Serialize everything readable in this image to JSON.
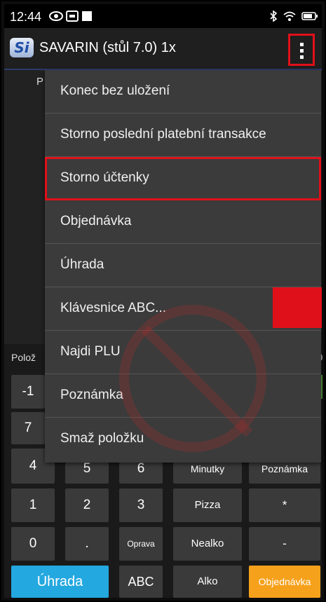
{
  "status_bar": {
    "time": "12:44"
  },
  "app_bar": {
    "logo": "Si",
    "title": "SAVARIN (stůl 7.0) 1x"
  },
  "background": {
    "partial_label": "P",
    "polozka_label": "Polož",
    "right_edge": "0"
  },
  "menu": {
    "items": [
      {
        "label": "Konec bez uložení"
      },
      {
        "label": "Storno poslední platební transakce"
      },
      {
        "label": "Storno účtenky"
      },
      {
        "label": "Objednávka"
      },
      {
        "label": "Úhrada"
      },
      {
        "label": "Klávesnice ABC..."
      },
      {
        "label": "Najdi PLU"
      },
      {
        "label": "Poznámka"
      },
      {
        "label": "Smaž položku"
      }
    ]
  },
  "keypad": {
    "row1": [
      "-1"
    ],
    "row2": [
      "7"
    ],
    "row3": [
      "4",
      "5",
      "6",
      "Minutky",
      "Poznámka"
    ],
    "row4": [
      "1",
      "2",
      "3",
      "Pizza",
      "*"
    ],
    "row5": [
      "0",
      ".",
      "Oprava",
      "Nealko",
      "-"
    ],
    "row6": [
      "Úhrada",
      "ABC",
      "Alko",
      "Objednávka"
    ]
  },
  "colors": {
    "highlight": "#e0101a",
    "uhrada": "#24a8e0",
    "objednavka": "#f6a11b"
  }
}
